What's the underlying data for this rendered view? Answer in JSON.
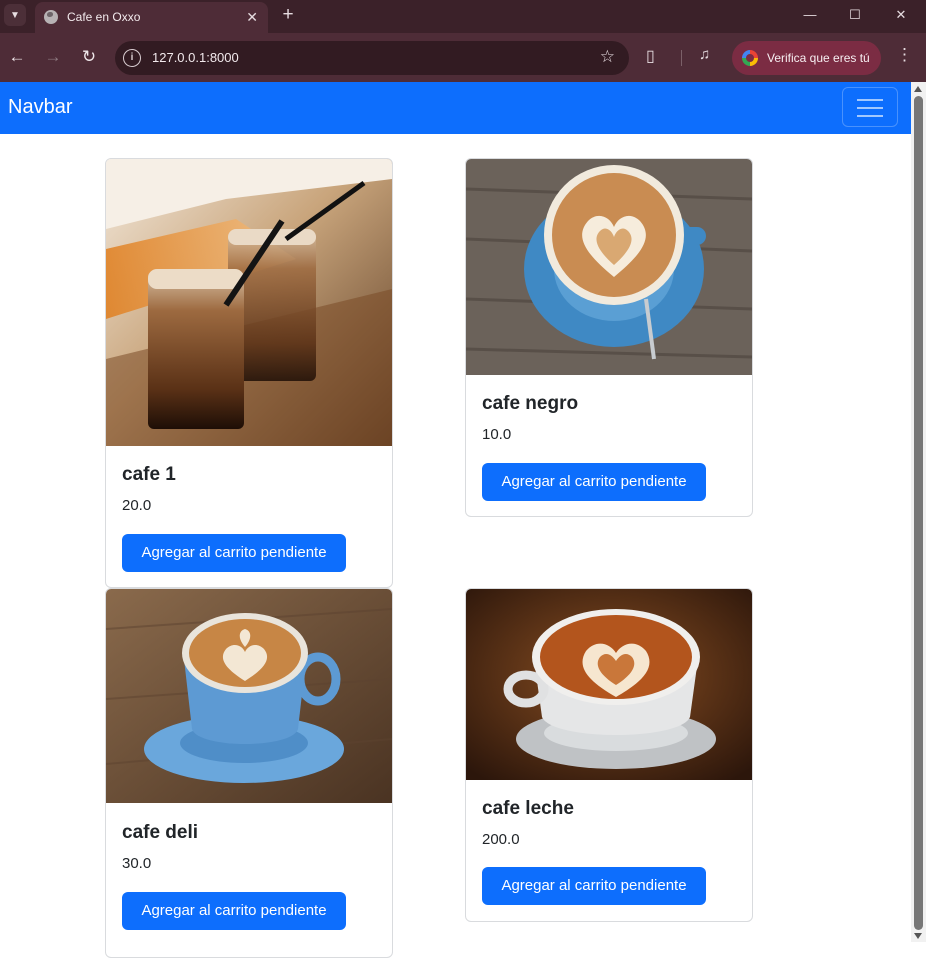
{
  "browser": {
    "tab_title": "Cafe en Oxxo",
    "url": "127.0.0.1:8000",
    "profile_button": "Verifica que eres tú",
    "icons": {
      "tab_search": "chevron-down-icon",
      "favicon": "globe-icon",
      "tab_close": "close-icon",
      "new_tab": "plus-icon",
      "minimize": "minimize-icon",
      "maximize": "maximize-icon",
      "window_close": "close-icon",
      "back": "arrow-left-icon",
      "forward": "arrow-right-icon",
      "reload": "reload-icon",
      "site_info": "info-icon",
      "bookmark": "star-icon",
      "extensions": "puzzle-icon",
      "media": "media-queue-icon",
      "menu": "kebab-menu-icon"
    }
  },
  "navbar": {
    "brand": "Navbar",
    "toggler_icon": "hamburger-icon"
  },
  "products": [
    {
      "name": "cafe 1",
      "price": "20.0",
      "button": "Agregar al carrito pendiente",
      "image": "iced-coffee-glasses"
    },
    {
      "name": "cafe negro",
      "price": "10.0",
      "button": "Agregar al carrito pendiente",
      "image": "latte-art-blue-cup"
    },
    {
      "name": "cafe deli",
      "price": "30.0",
      "button": "Agregar al carrito pendiente",
      "image": "latte-art-blue-cup"
    },
    {
      "name": "cafe leche",
      "price": "200.0",
      "button": "Agregar al carrito pendiente",
      "image": "latte-art-white-cup"
    }
  ],
  "colors": {
    "primary": "#0d6efd",
    "chrome_bg": "#4e2c37",
    "tabbar_bg": "#3b2129"
  }
}
